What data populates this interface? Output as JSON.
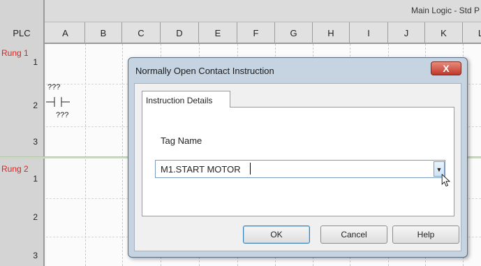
{
  "sheet": {
    "title": "Main Logic - Std P"
  },
  "columns": {
    "plc_label": "PLC",
    "letters": [
      "A",
      "B",
      "C",
      "D",
      "E",
      "F",
      "G",
      "H",
      "I",
      "J",
      "K",
      "L"
    ]
  },
  "rungs": [
    {
      "label": "Rung 1",
      "rows": [
        "1",
        "2",
        "3"
      ]
    },
    {
      "label": "Rung 2",
      "rows": [
        "1",
        "2",
        "3"
      ]
    }
  ],
  "ladder": {
    "contact_tag_top": "???",
    "contact_tag_bottom": "???"
  },
  "dialog": {
    "title": "Normally Open Contact Instruction",
    "close_label": "X",
    "tab_label": "Instruction Details",
    "tag_name_label": "Tag Name",
    "tag_name_value": "M1.START MOTOR",
    "buttons": {
      "ok": "OK",
      "cancel": "Cancel",
      "help": "Help"
    }
  }
}
